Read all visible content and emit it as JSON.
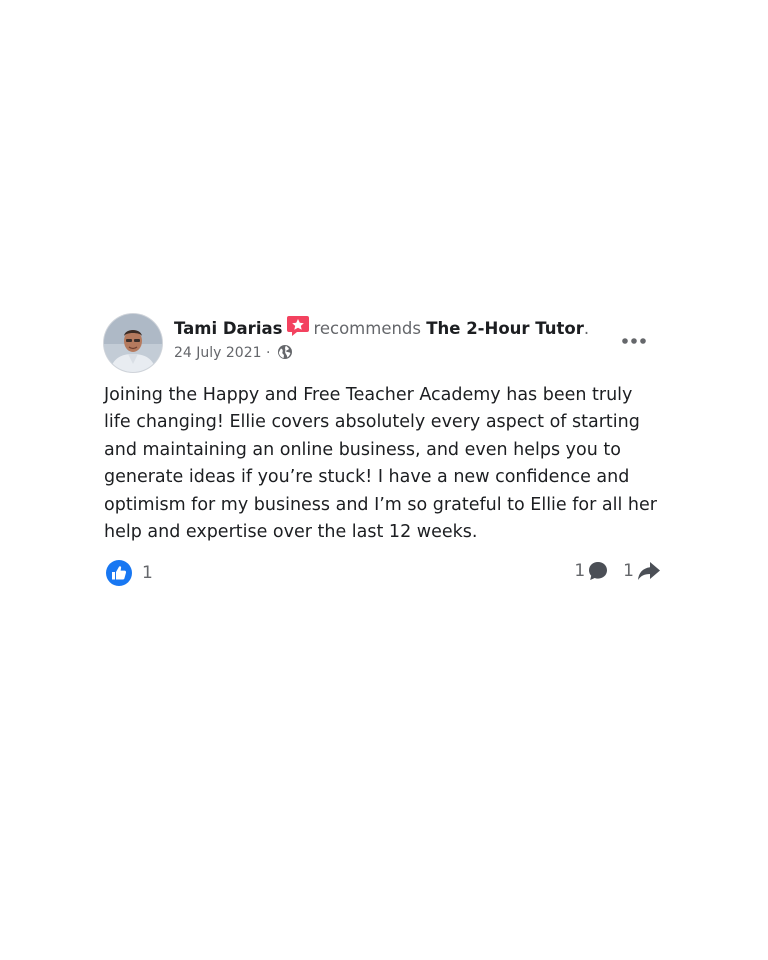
{
  "post": {
    "author": "Tami Darias",
    "recommends_text": "recommends",
    "page_name": "The 2-Hour Tutor",
    "period": ".",
    "date": "24 July 2021",
    "date_separator": "·",
    "body": "Joining the Happy and Free Teacher Academy has been truly life changing! Ellie covers absolutely every aspect of starting and maintaining an online business, and even helps you to generate ideas if you’re stuck! I have a new confidence and optimism for my business and I’m so grateful to Ellie for all her help and expertise over the last 12 weeks.",
    "reaction_count": "1",
    "comment_count": "1",
    "share_count": "1"
  },
  "icons": {
    "recommend": "recommend-star-icon",
    "privacy": "globe-icon",
    "more": "more-options-icon",
    "like": "like-thumb-icon",
    "comment": "comment-bubble-icon",
    "share": "share-arrow-icon"
  },
  "colors": {
    "recommend_red": "#f3425f",
    "like_blue": "#1877f2",
    "text_primary": "#1c1e21",
    "text_secondary": "#65676b"
  }
}
